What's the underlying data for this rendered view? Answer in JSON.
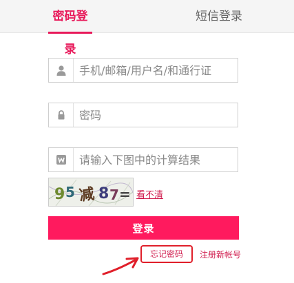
{
  "tabs": {
    "password_login": "密码登录",
    "sms_login": "短信登录"
  },
  "form": {
    "account_placeholder": "手机/邮箱/用户名/和通行证",
    "password_placeholder": "密码",
    "captcha_placeholder": "请输入下图中的计算结果"
  },
  "captcha": {
    "refresh_label": "看不清"
  },
  "actions": {
    "login_label": "登录",
    "forgot_password": "忘记密码",
    "register": "注册新帐号"
  },
  "icons": {
    "account": "user-icon",
    "password": "lock-icon",
    "captcha": "captcha-icon"
  },
  "colors": {
    "accent": "#e8195a",
    "button": "#ff1a5e",
    "highlight_box": "#e01f2a"
  }
}
